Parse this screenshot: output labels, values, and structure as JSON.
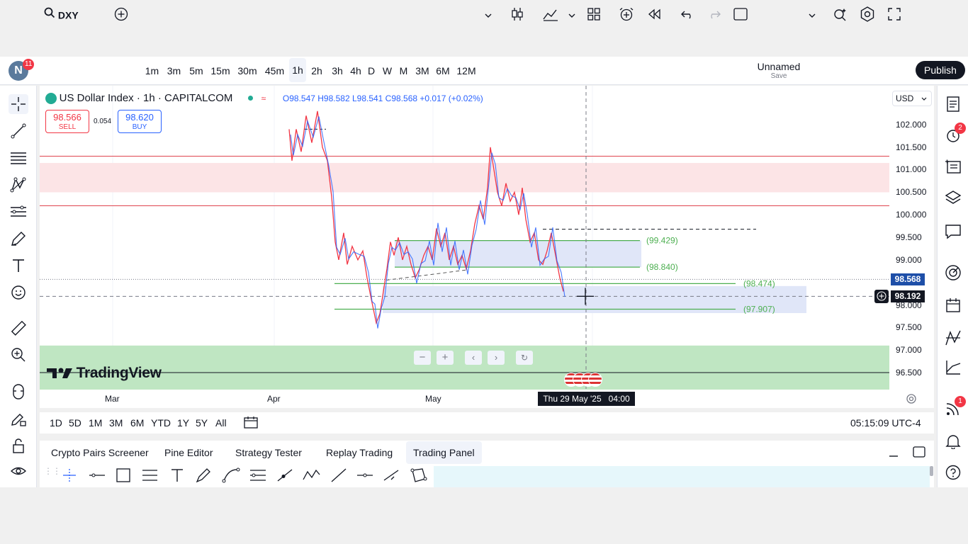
{
  "header": {
    "avatar_letter": "N",
    "avatar_badge": "11",
    "symbol": "DXY",
    "timeframes": [
      "1m",
      "3m",
      "5m",
      "15m",
      "30m",
      "45m",
      "1h",
      "2h",
      "3h",
      "4h",
      "D",
      "W",
      "M",
      "3M",
      "6M",
      "12M"
    ],
    "active_timeframe": "1h",
    "layout_name": "Unnamed",
    "layout_sub": "Save",
    "publish_label": "Publish"
  },
  "legend": {
    "title": "US Dollar Index · 1h · CAPITALCOM",
    "ohlc": "O98.547 H98.582 L98.541 C98.568 +0.017 (+0.02%)",
    "sell_price": "98.566",
    "sell_label": "SELL",
    "spread": "0.054",
    "buy_price": "98.620",
    "buy_label": "BUY",
    "currency": "USD"
  },
  "watermark": "TradingView",
  "chart_data": {
    "type": "candlestick",
    "title": "US Dollar Index · 1h · CAPITALCOM",
    "ylim": [
      96.2,
      102.4
    ],
    "y_ticks": [
      "102.000",
      "101.500",
      "101.000",
      "100.500",
      "100.000",
      "99.500",
      "99.000",
      "98.000",
      "97.500",
      "97.000",
      "96.500"
    ],
    "x_ticks": [
      "Mar",
      "Apr",
      "May"
    ],
    "last_price": "98.568",
    "crosshair_price": "98.192",
    "crosshair_time": "Thu 29 May '25   04:00",
    "levels": [
      {
        "label": "(99.429)",
        "value": 99.429
      },
      {
        "label": "(98.840)",
        "value": 98.84
      },
      {
        "label": "(98.474)",
        "value": 98.474
      },
      {
        "label": "(97.907)",
        "value": 97.907
      }
    ],
    "red_lines": [
      101.3,
      100.2
    ],
    "red_zone": [
      100.5,
      101.15
    ],
    "green_zone": [
      96.1,
      97.1
    ],
    "blue_zones": [
      [
        98.84,
        99.43
      ],
      [
        97.82,
        98.42
      ]
    ],
    "colors": {
      "up": "#2962ff",
      "down": "#f23645",
      "level": "#4caf50"
    }
  },
  "date_ranges": [
    "1D",
    "5D",
    "1M",
    "3M",
    "6M",
    "YTD",
    "1Y",
    "5Y",
    "All"
  ],
  "clock": "05:15:09 UTC-4",
  "bottom_tabs": [
    "Crypto Pairs Screener",
    "Pine Editor",
    "Strategy Tester",
    "Replay Trading",
    "Trading Panel"
  ],
  "right_badges": {
    "alerts": "2",
    "notifications": "1"
  }
}
